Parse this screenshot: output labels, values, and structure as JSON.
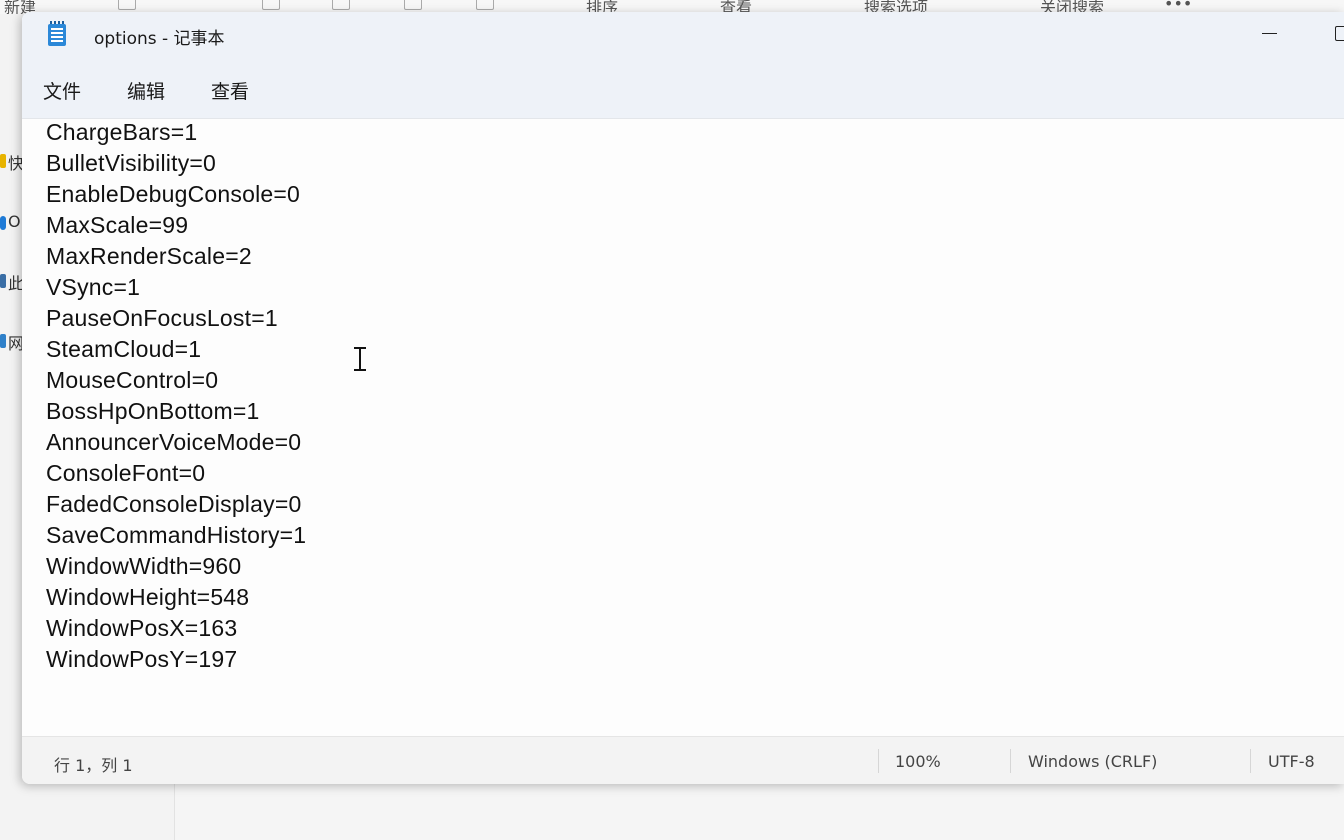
{
  "background": {
    "toolbar_items": [
      "新建",
      "排序",
      "查看",
      "搜索选项",
      "关闭搜索",
      "•••"
    ],
    "sidebar_items": [
      "快",
      "O",
      "此",
      "网"
    ]
  },
  "window": {
    "title": "options - 记事本",
    "app_icon": "notepad-icon"
  },
  "menu": {
    "file": "文件",
    "edit": "编辑",
    "view": "查看"
  },
  "editor": {
    "lines": [
      "ChargeBars=1",
      "BulletVisibility=0",
      "EnableDebugConsole=0",
      "MaxScale=99",
      "MaxRenderScale=2",
      "VSync=1",
      "PauseOnFocusLost=1",
      "SteamCloud=1",
      "MouseControl=0",
      "BossHpOnBottom=1",
      "AnnouncerVoiceMode=0",
      "ConsoleFont=0",
      "FadedConsoleDisplay=0",
      "SaveCommandHistory=1",
      "WindowWidth=960",
      "WindowHeight=548",
      "WindowPosX=163",
      "WindowPosY=197"
    ]
  },
  "status": {
    "position": "行 1，列 1",
    "zoom": "100%",
    "line_ending": "Windows (CRLF)",
    "encoding": "UTF-8"
  },
  "colors": {
    "titlebar_bg": "#eef2f8",
    "editor_bg": "#fdfdfd",
    "statusbar_bg": "#f3f3f3",
    "icon_blue": "#2b88d8"
  }
}
